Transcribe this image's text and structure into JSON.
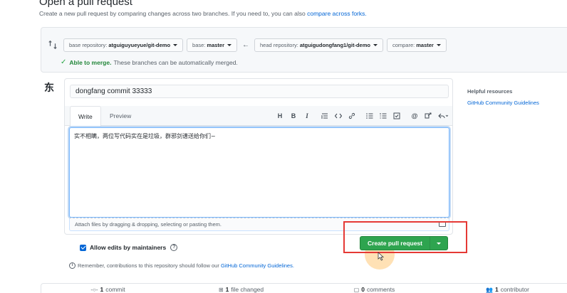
{
  "header": {
    "title": "Open a pull request",
    "subtitle": "Create a new pull request by comparing changes across two branches. If you need to, you can also",
    "subtitle_link": "compare across forks."
  },
  "range": {
    "base_repo_label": "base repository:",
    "base_repo_value": "atguiguyueyue/git-demo",
    "base_label": "base:",
    "base_value": "master",
    "head_repo_label": "head repository:",
    "head_repo_value": "atguigudongfang1/git-demo",
    "compare_label": "compare:",
    "compare_value": "master",
    "merge_ok": "Able to merge.",
    "merge_text": "These branches can be automatically merged."
  },
  "avatar": {
    "char": "东"
  },
  "compose": {
    "title_value": "dongfang commit 33333",
    "tabs": [
      "Write",
      "Preview"
    ],
    "toolbar": {
      "heading": "H",
      "bold": "B",
      "italic": "I"
    },
    "body_text": "实不相瞒，两位写代码实在是垃圾，群邪剑谱送给你们~",
    "attach_text": "Attach files by dragging & dropping, selecting or pasting them."
  },
  "actions": {
    "allow_edits": "Allow edits by maintainers",
    "create_button": "Create pull request",
    "remember_text": "Remember, contributions to this repository should follow our",
    "remember_link": "GitHub Community Guidelines."
  },
  "sidebar": {
    "heading": "Helpful resources",
    "link": "GitHub Community Guidelines"
  },
  "summary": {
    "commits_count": "1",
    "commits_label": "commit",
    "files_count": "1",
    "files_label": "file changed",
    "comments_count": "0",
    "comments_label": "comments",
    "contributors_count": "1",
    "contributors_label": "contributor"
  },
  "colors": {
    "accent": "#0366d6",
    "create_button": "#2ea44f",
    "highlight_box": "#e53935"
  }
}
